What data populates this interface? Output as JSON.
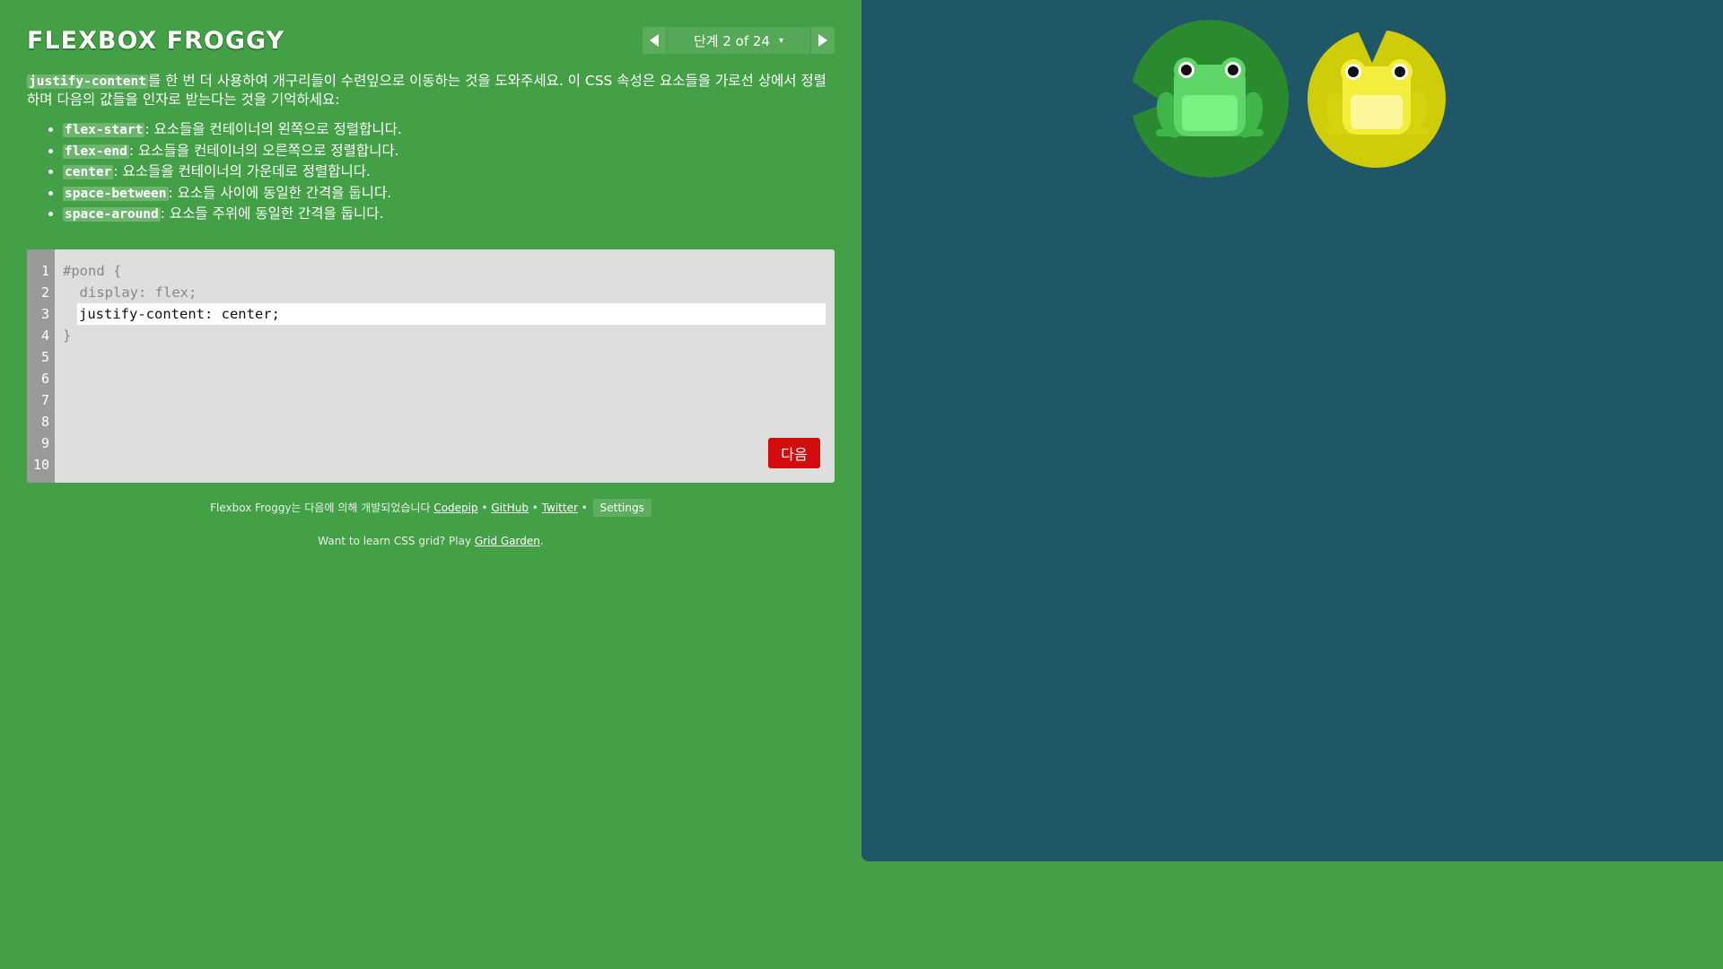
{
  "header": {
    "logo": "FLEXBOX FROGGY",
    "level_label": "단계 2 of 24",
    "level_caret": "▾"
  },
  "instructions": {
    "keyword": "justify-content",
    "text": "를 한 번 더 사용하여 개구리들이 수련잎으로 이동하는 것을 도와주세요. 이 CSS 속성은 요소들을 가로선 상에서 정렬하며 다음의 값들을 인자로 받는다는 것을 기억하세요:",
    "options": [
      {
        "value": "flex-start",
        "desc": ": 요소들을 컨테이너의 왼쪽으로 정렬합니다."
      },
      {
        "value": "flex-end",
        "desc": ": 요소들을 컨테이너의 오른쪽으로 정렬합니다."
      },
      {
        "value": "center",
        "desc": ": 요소들을 컨테이너의 가운데로 정렬합니다."
      },
      {
        "value": "space-between",
        "desc": ": 요소들 사이에 동일한 간격을 둡니다."
      },
      {
        "value": "space-around",
        "desc": ": 요소들 주위에 동일한 간격을 둡니다."
      }
    ]
  },
  "editor": {
    "line_numbers": [
      "1",
      "2",
      "3",
      "4",
      "5",
      "6",
      "7",
      "8",
      "9",
      "10"
    ],
    "line1": "#pond {",
    "line2": "  display: flex;",
    "input_value": "justify-content: center;",
    "line4": "}",
    "next_label": "다음"
  },
  "footer": {
    "credit_prefix": "Flexbox Froggy는 다음에 의해 개발되었습니다",
    "codepip": "Codepip",
    "github": "GitHub",
    "twitter": "Twitter",
    "sep": "•",
    "settings": "Settings",
    "grid_prefix": "Want to learn CSS grid? Play",
    "grid_link": "Grid Garden",
    "grid_suffix": "."
  },
  "colors": {
    "background": "#44a046",
    "pond": "#1f5768",
    "next_button": "#d30d0d",
    "green_frog": "#5fd467",
    "yellow_frog": "#f3ee3c"
  },
  "board": {
    "frogs": [
      {
        "color": "green"
      },
      {
        "color": "yellow"
      }
    ]
  }
}
